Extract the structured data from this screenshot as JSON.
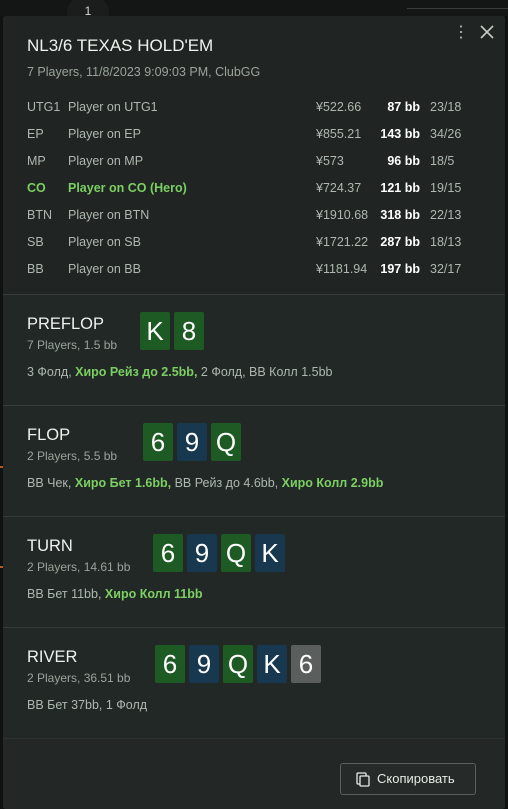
{
  "background": {
    "seat_number": "1"
  },
  "header": {
    "title": "NL3/6 TEXAS HOLD'EM",
    "subtitle": "7 Players, 11/8/2023 9:09:03 PM, ClubGG",
    "menu_icon": "kebab-vertical-icon",
    "close_icon": "close-x-icon"
  },
  "players": [
    {
      "position": "UTG1",
      "name": "Player on UTG1",
      "stack_money": "¥522.66",
      "stack_bb": "87 bb",
      "stats": "23/18",
      "hero": false
    },
    {
      "position": "EP",
      "name": "Player on EP",
      "stack_money": "¥855.21",
      "stack_bb": "143 bb",
      "stats": "34/26",
      "hero": false
    },
    {
      "position": "MP",
      "name": "Player on MP",
      "stack_money": "¥573",
      "stack_bb": "96 bb",
      "stats": "18/5",
      "hero": false
    },
    {
      "position": "CO",
      "name": "Player on CO (Hero)",
      "stack_money": "¥724.37",
      "stack_bb": "121 bb",
      "stats": "19/15",
      "hero": true
    },
    {
      "position": "BTN",
      "name": "Player on BTN",
      "stack_money": "¥1910.68",
      "stack_bb": "318 bb",
      "stats": "22/13",
      "hero": false
    },
    {
      "position": "SB",
      "name": "Player on SB",
      "stack_money": "¥1721.22",
      "stack_bb": "287 bb",
      "stats": "18/13",
      "hero": false
    },
    {
      "position": "BB",
      "name": "Player on BB",
      "stack_money": "¥1181.94",
      "stack_bb": "197 bb",
      "stats": "32/17",
      "hero": false
    }
  ],
  "streets": [
    {
      "name": "PREFLOP",
      "info": "7 Players, 1.5 bb",
      "cards": [
        {
          "rank": "K",
          "suit": "green"
        },
        {
          "rank": "8",
          "suit": "green"
        }
      ],
      "actions": [
        {
          "text": "3 Фолд, ",
          "hero": false
        },
        {
          "text": "Хиро Рейз до 2.5bb,",
          "hero": true
        },
        {
          "text": " 2 Фолд, BB Колл 1.5bb",
          "hero": false
        }
      ]
    },
    {
      "name": "FLOP",
      "info": "2 Players, 5.5 bb",
      "cards": [
        {
          "rank": "6",
          "suit": "green"
        },
        {
          "rank": "9",
          "suit": "blue"
        },
        {
          "rank": "Q",
          "suit": "green"
        }
      ],
      "actions": [
        {
          "text": "BB Чек, ",
          "hero": false
        },
        {
          "text": "Хиро Бет 1.6bb,",
          "hero": true
        },
        {
          "text": " BB Рейз до 4.6bb, ",
          "hero": false
        },
        {
          "text": "Хиро Колл 2.9bb",
          "hero": true
        }
      ]
    },
    {
      "name": "TURN",
      "info": "2 Players, 14.61 bb",
      "cards": [
        {
          "rank": "6",
          "suit": "green"
        },
        {
          "rank": "9",
          "suit": "blue"
        },
        {
          "rank": "Q",
          "suit": "green"
        },
        {
          "rank": "K",
          "suit": "blue"
        }
      ],
      "actions": [
        {
          "text": "BB Бет 11bb, ",
          "hero": false
        },
        {
          "text": "Хиро Колл 11bb",
          "hero": true
        }
      ]
    },
    {
      "name": "RIVER",
      "info": "2 Players, 36.51 bb",
      "cards": [
        {
          "rank": "6",
          "suit": "green"
        },
        {
          "rank": "9",
          "suit": "blue"
        },
        {
          "rank": "Q",
          "suit": "green"
        },
        {
          "rank": "K",
          "suit": "blue"
        },
        {
          "rank": "6",
          "suit": "grey"
        }
      ],
      "actions": [
        {
          "text": "BB Бет 37bb, 1 Фолд",
          "hero": false
        }
      ]
    }
  ],
  "footer": {
    "copy_label": "Скопировать",
    "copy_icon": "copy-icon"
  },
  "colors": {
    "hero_text": "#7ccf63",
    "suit_green": "#1e5b24",
    "suit_blue": "#17384f",
    "suit_grey": "#5a5e5c"
  }
}
